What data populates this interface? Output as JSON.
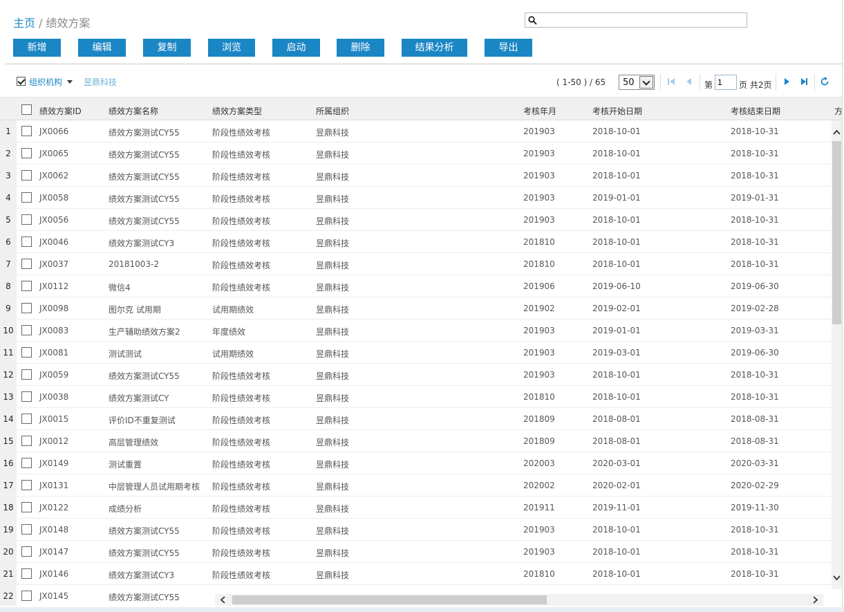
{
  "breadcrumb": {
    "home": "主页",
    "separator": "/",
    "current": "绩效方案"
  },
  "search": {
    "value": "",
    "placeholder": ""
  },
  "toolbar": {
    "buttons": [
      "新增",
      "编辑",
      "复制",
      "浏览",
      "启动",
      "删除",
      "结果分析",
      "导出"
    ]
  },
  "org": {
    "label": "组织机构",
    "checked": true,
    "name": "昱鼎科技"
  },
  "pager": {
    "range": "( 1-50 ) / 65",
    "page_size": "50",
    "page_prefix": "第",
    "page_value": "1",
    "page_suffix": "页 共2页"
  },
  "table": {
    "columns": [
      "绩效方案ID",
      "绩效方案名称",
      "绩效方案类型",
      "所属组织",
      "考核年月",
      "考核开始日期",
      "考核结束日期",
      "方"
    ],
    "rows": [
      [
        "1",
        "JX0066",
        "绩效方案测试CY55",
        "阶段性绩效考核",
        "昱鼎科技",
        "201903",
        "2018-10-01",
        "2018-10-31"
      ],
      [
        "2",
        "JX0065",
        "绩效方案测试CY55",
        "阶段性绩效考核",
        "昱鼎科技",
        "201903",
        "2018-10-01",
        "2018-10-31"
      ],
      [
        "3",
        "JX0062",
        "绩效方案测试CY55",
        "阶段性绩效考核",
        "昱鼎科技",
        "201903",
        "2018-10-01",
        "2018-10-31"
      ],
      [
        "4",
        "JX0058",
        "绩效方案测试CY55",
        "阶段性绩效考核",
        "昱鼎科技",
        "201903",
        "2019-01-01",
        "2019-01-31"
      ],
      [
        "5",
        "JX0056",
        "绩效方案测试CY55",
        "阶段性绩效考核",
        "昱鼎科技",
        "201903",
        "2018-10-01",
        "2018-10-31"
      ],
      [
        "6",
        "JX0046",
        "绩效方案测试CY3",
        "阶段性绩效考核",
        "昱鼎科技",
        "201810",
        "2018-10-01",
        "2018-10-31"
      ],
      [
        "7",
        "JX0037",
        "20181003-2",
        "阶段性绩效考核",
        "昱鼎科技",
        "201810",
        "2018-10-01",
        "2018-10-31"
      ],
      [
        "8",
        "JX0112",
        "微信4",
        "阶段性绩效考核",
        "昱鼎科技",
        "201906",
        "2019-06-10",
        "2019-06-30"
      ],
      [
        "9",
        "JX0098",
        "图尔克 试用期",
        "试用期绩效",
        "昱鼎科技",
        "201902",
        "2019-02-01",
        "2019-02-28"
      ],
      [
        "10",
        "JX0083",
        "生产辅助绩效方案2",
        "年度绩效",
        "昱鼎科技",
        "201903",
        "2019-01-01",
        "2019-03-31"
      ],
      [
        "11",
        "JX0081",
        "测试测试",
        "试用期绩效",
        "昱鼎科技",
        "201903",
        "2019-03-01",
        "2019-06-30"
      ],
      [
        "12",
        "JX0059",
        "绩效方案测试CY55",
        "阶段性绩效考核",
        "昱鼎科技",
        "201903",
        "2018-10-01",
        "2018-10-31"
      ],
      [
        "13",
        "JX0038",
        "绩效方案测试CY",
        "阶段性绩效考核",
        "昱鼎科技",
        "201810",
        "2018-10-01",
        "2018-10-31"
      ],
      [
        "14",
        "JX0015",
        "评价ID不重复测试",
        "阶段性绩效考核",
        "昱鼎科技",
        "201809",
        "2018-08-01",
        "2018-08-31"
      ],
      [
        "15",
        "JX0012",
        "高层管理绩效",
        "阶段性绩效考核",
        "昱鼎科技",
        "201809",
        "2018-08-01",
        "2018-08-31"
      ],
      [
        "16",
        "JX0149",
        "测试重置",
        "阶段性绩效考核",
        "昱鼎科技",
        "202003",
        "2020-03-01",
        "2020-03-31"
      ],
      [
        "17",
        "JX0131",
        "中层管理人员试用期考核",
        "阶段性绩效考核",
        "昱鼎科技",
        "202002",
        "2020-02-01",
        "2020-02-29"
      ],
      [
        "18",
        "JX0122",
        "成绩分析",
        "阶段性绩效考核",
        "昱鼎科技",
        "201911",
        "2019-11-01",
        "2019-11-30"
      ],
      [
        "19",
        "JX0148",
        "绩效方案测试CY55",
        "阶段性绩效考核",
        "昱鼎科技",
        "201903",
        "2018-10-01",
        "2018-10-31"
      ],
      [
        "20",
        "JX0147",
        "绩效方案测试CY55",
        "阶段性绩效考核",
        "昱鼎科技",
        "201903",
        "2018-10-01",
        "2018-10-31"
      ],
      [
        "21",
        "JX0146",
        "绩效方案测试CY3",
        "阶段性绩效考核",
        "昱鼎科技",
        "201810",
        "2018-10-01",
        "2018-10-31"
      ],
      [
        "22",
        "JX0145",
        "绩效方案测试CY55",
        "",
        "",
        "",
        "",
        ""
      ]
    ]
  },
  "colors": {
    "accent": "#1a86c4",
    "header_bg": "#f0f0f0",
    "link_light": "#6fb1d8"
  }
}
